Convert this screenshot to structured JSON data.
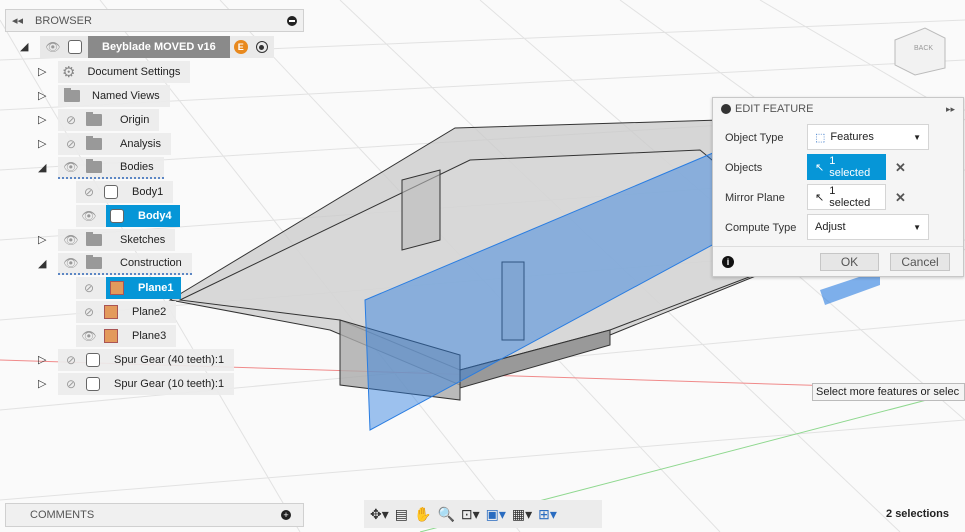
{
  "browser": {
    "title": "BROWSER",
    "root": {
      "label": "Beyblade MOVED v16",
      "badge": "E"
    },
    "items": [
      {
        "label": "Document Settings"
      },
      {
        "label": "Named Views"
      },
      {
        "label": "Origin"
      },
      {
        "label": "Analysis"
      },
      {
        "label": "Bodies"
      },
      {
        "label": "Body1"
      },
      {
        "label": "Body4"
      },
      {
        "label": "Sketches"
      },
      {
        "label": "Construction"
      },
      {
        "label": "Plane1"
      },
      {
        "label": "Plane2"
      },
      {
        "label": "Plane3"
      },
      {
        "label": "Spur Gear (40 teeth):1"
      },
      {
        "label": "Spur Gear (10 teeth):1"
      }
    ]
  },
  "edit_feature": {
    "title": "EDIT FEATURE",
    "object_type": {
      "label": "Object Type",
      "value": "Features"
    },
    "objects": {
      "label": "Objects",
      "value": "1 selected"
    },
    "mirror_plane": {
      "label": "Mirror Plane",
      "value": "1 selected"
    },
    "compute_type": {
      "label": "Compute Type",
      "value": "Adjust"
    },
    "ok": "OK",
    "cancel": "Cancel"
  },
  "tooltip": "Select more features or selec",
  "viewcube": {
    "face": "BACK"
  },
  "comments": {
    "title": "COMMENTS"
  },
  "status": "2 selections",
  "colors": {
    "accent": "#0696d7",
    "plane": "#e39a5c"
  }
}
